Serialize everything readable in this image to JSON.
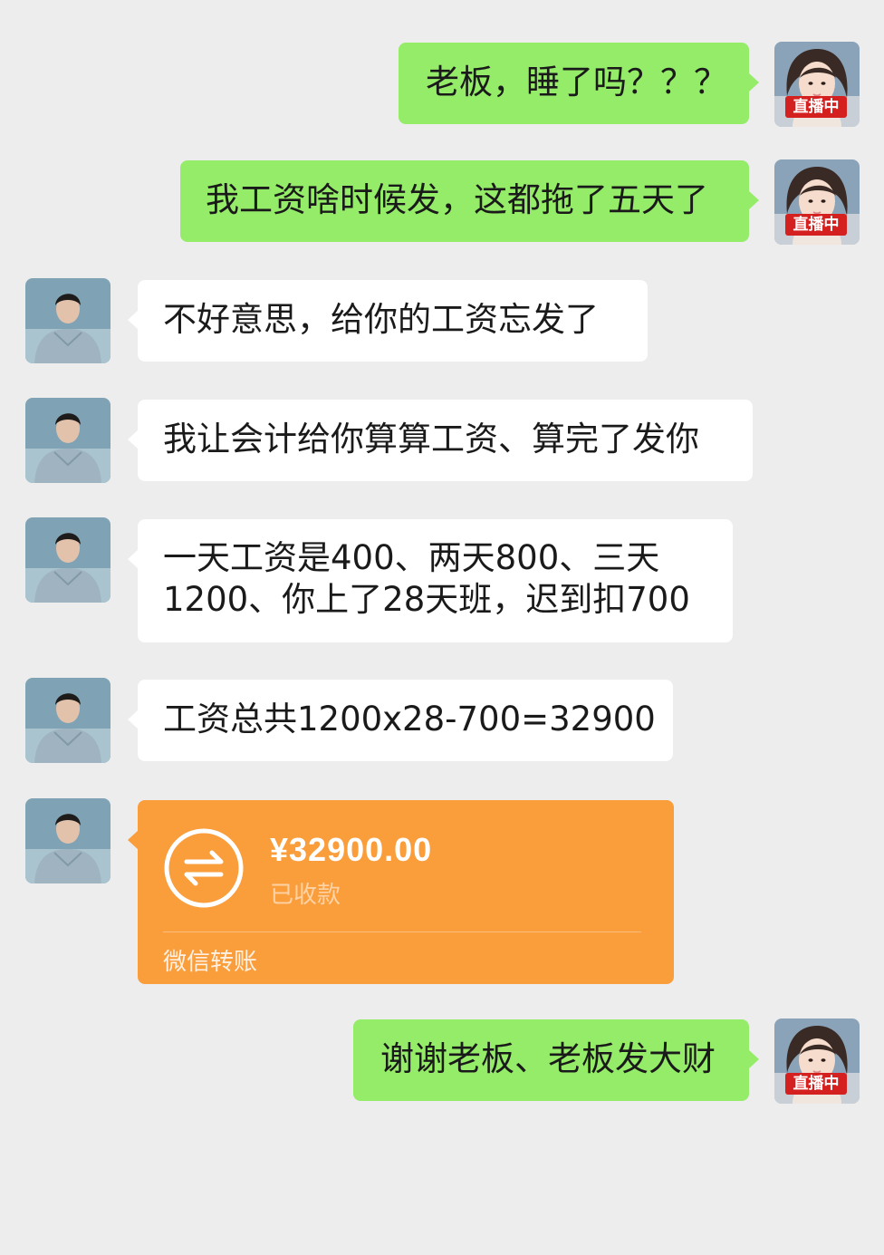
{
  "messages": [
    {
      "sender": "self",
      "text": "老板，睡了吗？？？"
    },
    {
      "sender": "self",
      "text": "我工资啥时候发，这都拖了五天了"
    },
    {
      "sender": "boss",
      "text": "不好意思，给你的工资忘发了"
    },
    {
      "sender": "boss",
      "text": "我让会计给你算算工资、算完了发你"
    },
    {
      "sender": "boss",
      "text_lines": [
        "一天工资是400、两天800、三天",
        "1200、你上了28天班，迟到扣700"
      ]
    },
    {
      "sender": "boss",
      "text": "工资总共1200x28-700=32900"
    },
    {
      "sender": "self",
      "text": "谢谢老板、老板发大财"
    }
  ],
  "transfer": {
    "amount": "¥32900.00",
    "status": "已收款",
    "label": "微信转账",
    "icon": "transfer-arrows-icon"
  },
  "self_avatar": {
    "badge": "直播中",
    "badge_color": "#d4201f"
  },
  "colors": {
    "background": "#ededed",
    "self_bubble": "#95ec69",
    "boss_bubble": "#ffffff",
    "transfer_card": "#fa9d3b"
  }
}
